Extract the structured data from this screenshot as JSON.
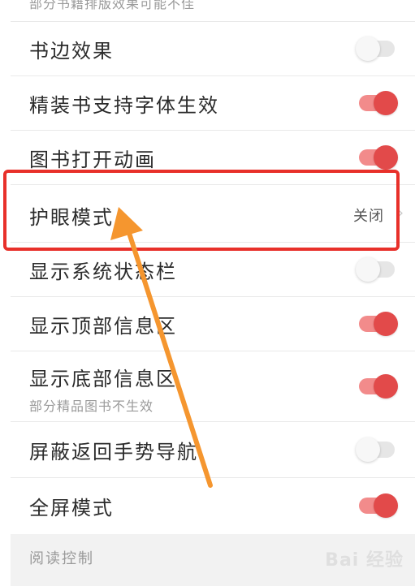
{
  "settings": {
    "top_sub": "部分书籍排版效果可能不佳",
    "items": [
      {
        "label": "书边效果",
        "toggle": "off"
      },
      {
        "label": "精装书支持字体生效",
        "toggle": "on"
      },
      {
        "label": "图书打开动画",
        "toggle": "on"
      },
      {
        "label": "护眼模式",
        "value": "关闭"
      },
      {
        "label": "显示系统状态栏",
        "toggle": "off"
      },
      {
        "label": "显示顶部信息区",
        "toggle": "on"
      },
      {
        "label": "显示底部信息区",
        "sub": "部分精品图书不生效",
        "toggle": "on"
      },
      {
        "label": "屏蔽返回手势导航",
        "toggle": "off"
      },
      {
        "label": "全屏模式",
        "toggle": "on"
      }
    ],
    "section_label": "阅读控制"
  },
  "watermark": "Bai 经验",
  "colors": {
    "accent": "#e24a4a",
    "highlight": "#e8302a",
    "arrow": "#f5962f"
  }
}
